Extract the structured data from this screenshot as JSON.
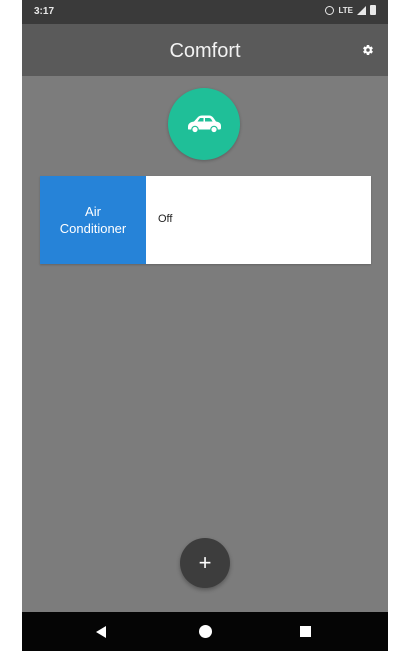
{
  "status_bar": {
    "time": "3:17",
    "network": "LTE",
    "icons": [
      "alarm-icon",
      "signal-icon",
      "battery-icon"
    ]
  },
  "app_bar": {
    "title": "Comfort",
    "settings_icon": "gear-icon"
  },
  "room": {
    "icon": "car-icon",
    "color": "#1fbf98"
  },
  "devices": [
    {
      "name_line1": "Air",
      "name_line2": "Conditioner",
      "state": "Off",
      "color": "#2683d8"
    }
  ],
  "fab": {
    "label": "+",
    "icon": "plus-icon"
  },
  "nav_bar": {
    "icons": [
      "back-icon",
      "home-icon",
      "recents-icon"
    ]
  }
}
